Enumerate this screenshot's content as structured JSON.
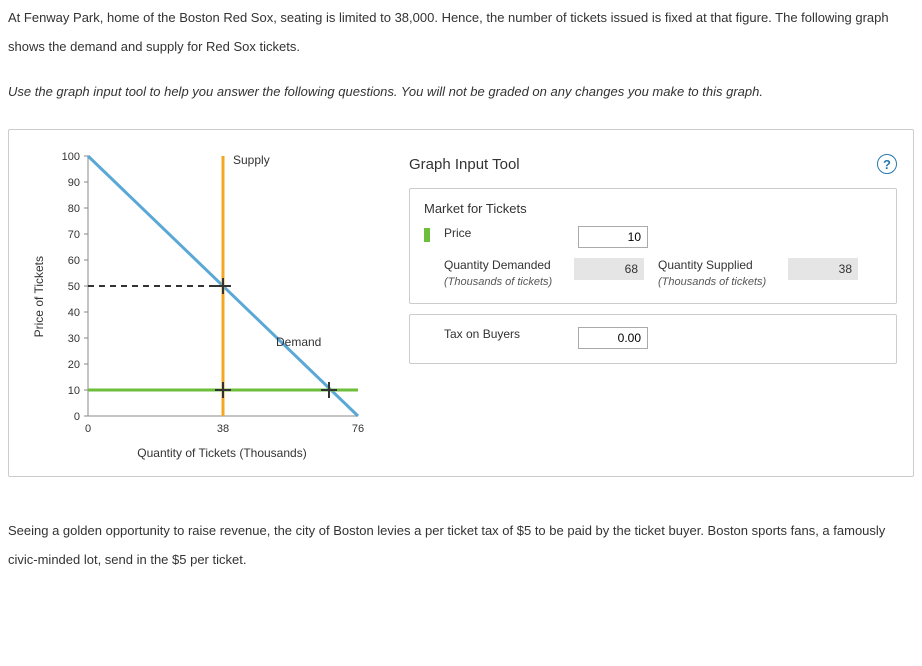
{
  "intro": "At Fenway Park, home of the Boston Red Sox, seating is limited to 38,000. Hence, the number of tickets issued is fixed at that figure. The following graph shows the demand and supply for Red Sox tickets.",
  "instruction": "Use the graph input tool to help you answer the following questions. You will not be graded on any changes you make to this graph.",
  "outro": "Seeing a golden opportunity to raise revenue, the city of Boston levies a per ticket tax of $5 to be paid by the ticket buyer. Boston sports fans, a famously civic-minded lot, send in the $5 per ticket.",
  "chart": {
    "y_label": "Price of Tickets",
    "x_label": "Quantity of Tickets (Thousands)",
    "supply_label": "Supply",
    "demand_label": "Demand",
    "y_ticks": [
      "0",
      "10",
      "20",
      "30",
      "40",
      "50",
      "60",
      "70",
      "80",
      "90",
      "100"
    ],
    "x_ticks": [
      "0",
      "38",
      "76"
    ]
  },
  "tool": {
    "title": "Graph Input Tool",
    "help": "?",
    "group_market": "Market for Tickets",
    "price_label": "Price",
    "price_value": "10",
    "qd_label": "Quantity Demanded",
    "qd_sub": "(Thousands of tickets)",
    "qd_value": "68",
    "qs_label": "Quantity Supplied",
    "qs_sub": "(Thousands of tickets)",
    "qs_value": "38",
    "tax_label": "Tax on Buyers",
    "tax_value": "0.00"
  },
  "chart_data": {
    "type": "line",
    "title": "Market for Tickets",
    "xlabel": "Quantity of Tickets (Thousands)",
    "ylabel": "Price of Tickets",
    "xlim": [
      0,
      76
    ],
    "ylim": [
      0,
      100
    ],
    "series": [
      {
        "name": "Demand",
        "x": [
          0,
          76
        ],
        "y": [
          100,
          0
        ],
        "color": "#3b8fc4"
      },
      {
        "name": "Supply (vertical)",
        "x": [
          38,
          38
        ],
        "y": [
          0,
          100
        ],
        "color": "#f5a623"
      },
      {
        "name": "Price line",
        "x": [
          0,
          76
        ],
        "y": [
          10,
          10
        ],
        "color": "#6dbf3b"
      }
    ],
    "annotations": [
      {
        "type": "dashed",
        "from": [
          0,
          50
        ],
        "to": [
          38,
          50
        ]
      },
      {
        "type": "handle",
        "x": 38,
        "y": 50
      },
      {
        "type": "handle",
        "x": 38,
        "y": 10
      },
      {
        "type": "handle",
        "x": 68,
        "y": 10
      }
    ]
  }
}
